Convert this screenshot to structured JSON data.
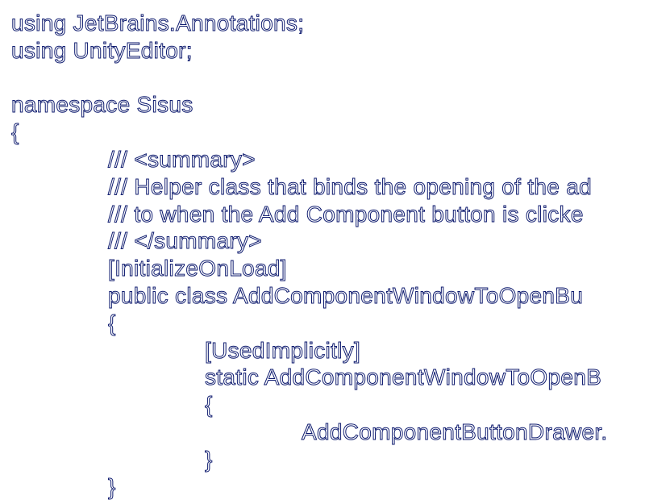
{
  "code_lines": [
    {
      "indent": 0,
      "text": "using JetBrains.Annotations;"
    },
    {
      "indent": 0,
      "text": "using UnityEditor;"
    },
    {
      "indent": 0,
      "text": ""
    },
    {
      "indent": 0,
      "text": "namespace Sisus"
    },
    {
      "indent": 0,
      "text": "{"
    },
    {
      "indent": 1,
      "text": "/// <summary>"
    },
    {
      "indent": 1,
      "text": "/// Helper class that binds the opening of the ad"
    },
    {
      "indent": 1,
      "text": "/// to when the Add Component button is clicke"
    },
    {
      "indent": 1,
      "text": "/// </summary>"
    },
    {
      "indent": 1,
      "text": "[InitializeOnLoad]"
    },
    {
      "indent": 1,
      "text": "public class AddComponentWindowToOpenBu"
    },
    {
      "indent": 1,
      "text": "{"
    },
    {
      "indent": 2,
      "text": "[UsedImplicitly]"
    },
    {
      "indent": 2,
      "text": "static AddComponentWindowToOpenB"
    },
    {
      "indent": 2,
      "text": "{"
    },
    {
      "indent": 3,
      "text": "AddComponentButtonDrawer."
    },
    {
      "indent": 2,
      "text": "}"
    },
    {
      "indent": 1,
      "text": "}"
    }
  ]
}
